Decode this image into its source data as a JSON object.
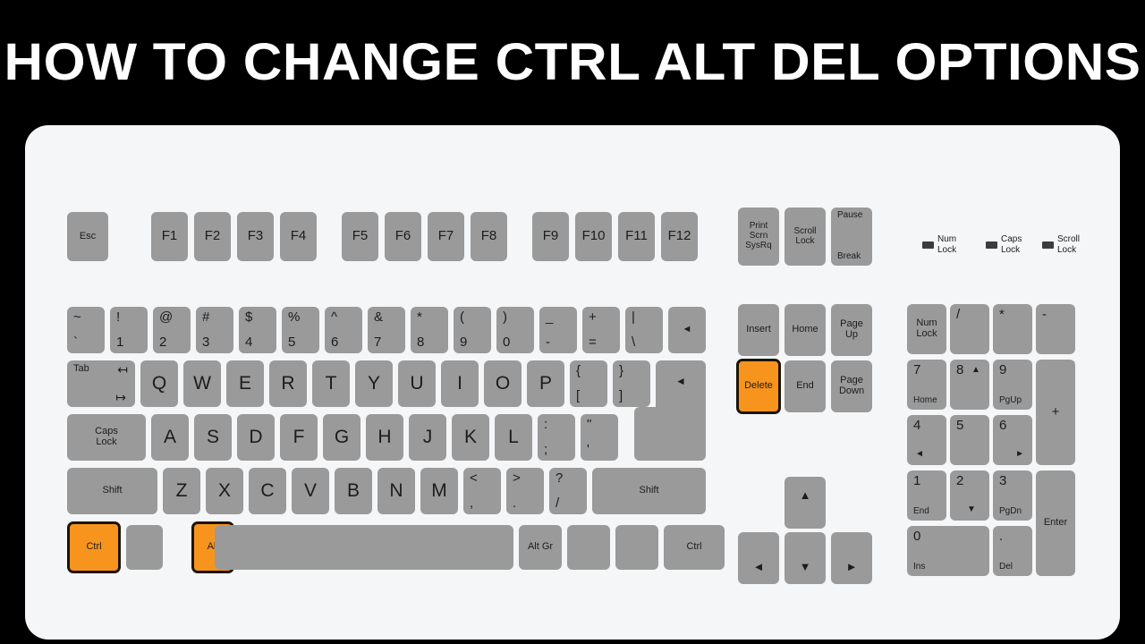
{
  "page_title": "HOW TO CHANGE CTRL ALT DEL OPTIONS",
  "colors": {
    "background": "#000000",
    "title_text": "#ffffff",
    "keyboard_body": "#f5f6f8",
    "key_fill": "#9a9a9a",
    "key_text": "#1c1c1c",
    "highlight_fill": "#f7941e",
    "highlight_border": "#1d1407",
    "led_fill": "#3c3c3c"
  },
  "keyboard": {
    "function_row": [
      {
        "name": "esc",
        "label": "Esc"
      },
      {
        "name": "f1",
        "label": "F1"
      },
      {
        "name": "f2",
        "label": "F2"
      },
      {
        "name": "f3",
        "label": "F3"
      },
      {
        "name": "f4",
        "label": "F4"
      },
      {
        "name": "f5",
        "label": "F5"
      },
      {
        "name": "f6",
        "label": "F6"
      },
      {
        "name": "f7",
        "label": "F7"
      },
      {
        "name": "f8",
        "label": "F8"
      },
      {
        "name": "f9",
        "label": "F9"
      },
      {
        "name": "f10",
        "label": "F10"
      },
      {
        "name": "f11",
        "label": "F11"
      },
      {
        "name": "f12",
        "label": "F12"
      }
    ],
    "number_row": [
      {
        "name": "backtick",
        "top": "~",
        "bottom": "`"
      },
      {
        "name": "digit-1",
        "top": "!",
        "bottom": "1"
      },
      {
        "name": "digit-2",
        "top": "@",
        "bottom": "2"
      },
      {
        "name": "digit-3",
        "top": "#",
        "bottom": "3"
      },
      {
        "name": "digit-4",
        "top": "$",
        "bottom": "4"
      },
      {
        "name": "digit-5",
        "top": "%",
        "bottom": "5"
      },
      {
        "name": "digit-6",
        "top": "^",
        "bottom": "6"
      },
      {
        "name": "digit-7",
        "top": "&",
        "bottom": "7"
      },
      {
        "name": "digit-8",
        "top": "*",
        "bottom": "8"
      },
      {
        "name": "digit-9",
        "top": "(",
        "bottom": "9"
      },
      {
        "name": "digit-0",
        "top": ")",
        "bottom": "0"
      },
      {
        "name": "minus",
        "top": "_",
        "bottom": "-"
      },
      {
        "name": "equals",
        "top": "+",
        "bottom": "="
      },
      {
        "name": "backslash",
        "top": "|",
        "bottom": "\\"
      }
    ],
    "backspace": {
      "label": "◄"
    },
    "tab_row": {
      "tab": {
        "label": "Tab",
        "glyph_top": "↤",
        "glyph_bottom": "↦"
      },
      "letters": [
        "Q",
        "W",
        "E",
        "R",
        "T",
        "Y",
        "U",
        "I",
        "O",
        "P"
      ],
      "bracket_left": {
        "top": "{",
        "bottom": "["
      },
      "bracket_right": {
        "top": "}",
        "bottom": "]"
      }
    },
    "enter": {
      "label": "◄"
    },
    "home_row": {
      "caps_lock": {
        "label": "Caps\nLock"
      },
      "letters": [
        "A",
        "S",
        "D",
        "F",
        "G",
        "H",
        "J",
        "K",
        "L"
      ],
      "semicolon": {
        "top": ":",
        "bottom": ";"
      },
      "quote": {
        "top": "\"",
        "bottom": "'"
      }
    },
    "shift_row": {
      "shift_left": {
        "label": "Shift"
      },
      "letters": [
        "Z",
        "X",
        "C",
        "V",
        "B",
        "N",
        "M"
      ],
      "comma": {
        "top": "<",
        "bottom": ","
      },
      "period": {
        "top": ">",
        "bottom": "."
      },
      "slash": {
        "top": "?",
        "bottom": "/"
      },
      "shift_right": {
        "label": "Shift"
      }
    },
    "bottom_row": {
      "ctrl_left": {
        "label": "Ctrl",
        "highlighted": true
      },
      "win_left": {
        "label": ""
      },
      "alt_left": {
        "label": "Alt",
        "highlighted": true
      },
      "space": {
        "label": ""
      },
      "alt_gr": {
        "label": "Alt Gr"
      },
      "win_right": {
        "label": ""
      },
      "menu": {
        "label": ""
      },
      "ctrl_right": {
        "label": "Ctrl"
      }
    },
    "system_cluster": [
      {
        "name": "print-screen",
        "label": "Print\nScrn\nSysRq"
      },
      {
        "name": "scroll-lock",
        "label": "Scroll\nLock"
      },
      {
        "name": "pause-break",
        "top": "Pause",
        "bottom": "Break"
      }
    ],
    "nav_cluster": [
      {
        "name": "insert",
        "label": "Insert",
        "highlighted": false
      },
      {
        "name": "home",
        "label": "Home",
        "highlighted": false
      },
      {
        "name": "page-up",
        "label": "Page\nUp",
        "highlighted": false
      },
      {
        "name": "delete",
        "label": "Delete",
        "highlighted": true
      },
      {
        "name": "end",
        "label": "End",
        "highlighted": false
      },
      {
        "name": "page-down",
        "label": "Page\nDown",
        "highlighted": false
      }
    ],
    "arrow_cluster": {
      "up": "▲",
      "left": "◄",
      "down": "▼",
      "right": "►"
    },
    "leds": [
      {
        "name": "num-lock",
        "label": "Num\nLock"
      },
      {
        "name": "caps-lock",
        "label": "Caps\nLock"
      },
      {
        "name": "scroll-lock",
        "label": "Scroll\nLock"
      }
    ],
    "numpad": {
      "num_lock": {
        "label": "Num\nLock"
      },
      "divide": {
        "label": "/"
      },
      "multiply": {
        "label": "*"
      },
      "subtract": {
        "label": "-"
      },
      "key7": {
        "top": "7",
        "bottom": "Home"
      },
      "key8": {
        "top": "8",
        "arrow": "▲"
      },
      "key9": {
        "top": "9",
        "bottom": "PgUp"
      },
      "add": {
        "label": "+"
      },
      "key4": {
        "top": "4",
        "arrow": "◄"
      },
      "key5": {
        "top": "5"
      },
      "key6": {
        "top": "6",
        "arrow": "►"
      },
      "key1": {
        "top": "1",
        "bottom": "End"
      },
      "key2": {
        "top": "2",
        "arrow": "▼"
      },
      "key3": {
        "top": "3",
        "bottom": "PgDn"
      },
      "enter": {
        "label": "Enter"
      },
      "key0": {
        "top": "0",
        "bottom": "Ins"
      },
      "decimal": {
        "top": ".",
        "bottom": "Del"
      }
    }
  }
}
